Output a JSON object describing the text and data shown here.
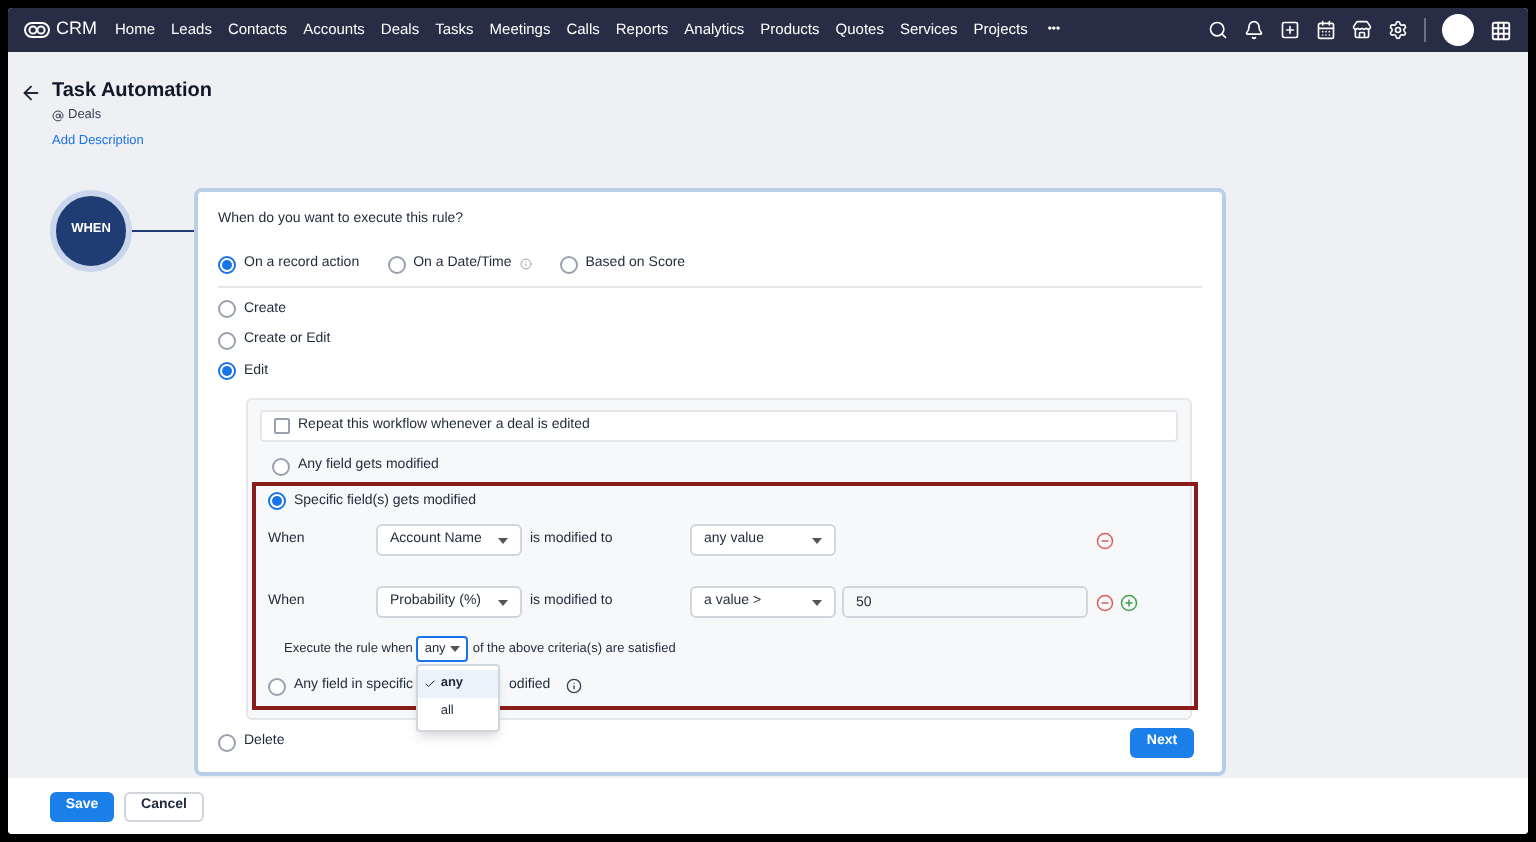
{
  "nav": {
    "brand": "CRM",
    "items": [
      "Home",
      "Leads",
      "Contacts",
      "Accounts",
      "Deals",
      "Tasks",
      "Meetings",
      "Calls",
      "Reports",
      "Analytics",
      "Products",
      "Quotes",
      "Services",
      "Projects"
    ],
    "more": "•••"
  },
  "header": {
    "title": "Task Automation",
    "module": "Deals",
    "add_description": "Add Description"
  },
  "step": {
    "label": "WHEN"
  },
  "question": "When do you want to execute this rule?",
  "trigger_types": [
    {
      "label": "On a record action",
      "selected": true,
      "info": false
    },
    {
      "label": "On a Date/Time",
      "selected": false,
      "info": true
    },
    {
      "label": "Based on Score",
      "selected": false,
      "info": false
    }
  ],
  "actions": [
    {
      "label": "Create",
      "selected": false
    },
    {
      "label": "Create or Edit",
      "selected": false
    },
    {
      "label": "Edit",
      "selected": true
    }
  ],
  "repeat": {
    "label": "Repeat this workflow whenever a deal is edited",
    "checked": false
  },
  "modify_modes": [
    {
      "label": "Any field gets modified",
      "selected": false
    },
    {
      "label": "Specific field(s) gets modified",
      "selected": true
    }
  ],
  "criteria": [
    {
      "label": "When",
      "field": "Account Name",
      "operator_text": "is modified to",
      "condition": "any value",
      "add": false
    },
    {
      "label": "When",
      "field": "Probability (%)",
      "operator_text": "is modified to",
      "condition": "a value >",
      "value": "50",
      "add": true
    }
  ],
  "match": {
    "prefix": "Execute the rule when",
    "value": "any",
    "suffix": "of the above criteria(s) are satisfied",
    "expanded": true,
    "options": [
      {
        "label": "any",
        "selected": true
      },
      {
        "label": "all",
        "selected": false
      }
    ]
  },
  "section_mode": {
    "label_before": "Any field in specific",
    "label_after": "odified",
    "selected": false
  },
  "delete_option": {
    "label": "Delete",
    "selected": false
  },
  "buttons": {
    "next": "Next",
    "save": "Save",
    "cancel": "Cancel"
  }
}
